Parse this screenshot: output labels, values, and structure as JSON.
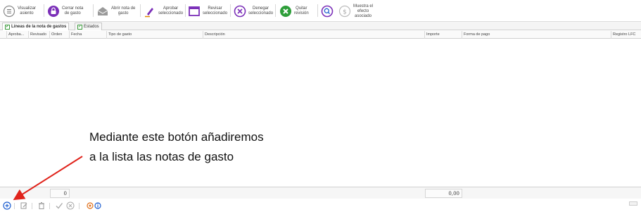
{
  "toolbar": {
    "visualizar": "Visualizar\nasiento",
    "cerrar": "Cerrar nota\nde gasto",
    "abrir": "Abrir nota de\ngasto",
    "aprobar": "Aprobar\nseleccionado",
    "revisar": "Revisar\nseleccionado",
    "denegar": "Denegar\nseleccionado",
    "quitar": "Quitar\nrevisión",
    "muestra": "Muestra el\nefecto\nasociado"
  },
  "tabs": {
    "lineas": "Líneas de la nota de gastos",
    "estados": "Estados"
  },
  "columns": {
    "aprobado": "Aproba...",
    "revisado": "Revisado",
    "orden": "Orden",
    "fecha": "Fecha",
    "tipo": "Tipo de gasto",
    "descripcion": "Descripción",
    "importe": "Importe",
    "forma": "Forma de pago",
    "registro": "Registro LFC"
  },
  "totals": {
    "count": "0",
    "importe": "0,00"
  },
  "annotation": {
    "line1": "Mediante este botón añadiremos",
    "line2": "a la lista las notas de gasto"
  },
  "colors": {
    "accent": "#7b2fb8",
    "green": "#2e9e3a",
    "blue": "#1f5fd0",
    "arrow": "#e0231b"
  }
}
